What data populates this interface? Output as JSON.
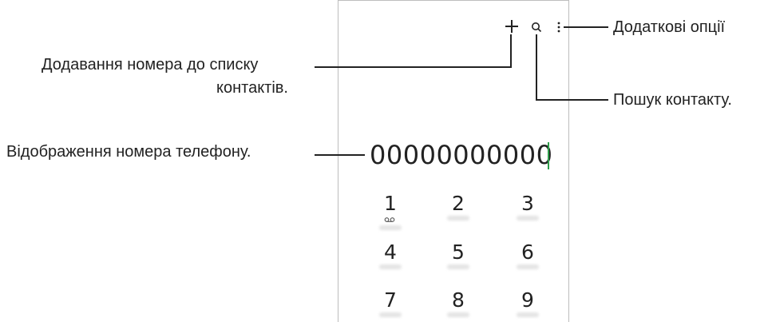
{
  "callouts": {
    "add_contact": "Додавання номера до списку",
    "add_contact_2": "контактів.",
    "more_options": "Додаткові опції",
    "search_contact": "Пошук контакту.",
    "phone_display": "Відображення номера телефону."
  },
  "dialer": {
    "number": "00000000000",
    "keys": [
      {
        "digit": "1",
        "icon": "voicemail-icon"
      },
      {
        "digit": "2"
      },
      {
        "digit": "3"
      },
      {
        "digit": "4"
      },
      {
        "digit": "5"
      },
      {
        "digit": "6"
      },
      {
        "digit": "7"
      },
      {
        "digit": "8"
      },
      {
        "digit": "9"
      }
    ],
    "toolbar_icons": [
      "plus-icon",
      "search-icon",
      "more-options-icon"
    ]
  },
  "colors": {
    "cursor": "#2e9d4a",
    "text": "#222222",
    "frame": "#bdbdbd"
  }
}
